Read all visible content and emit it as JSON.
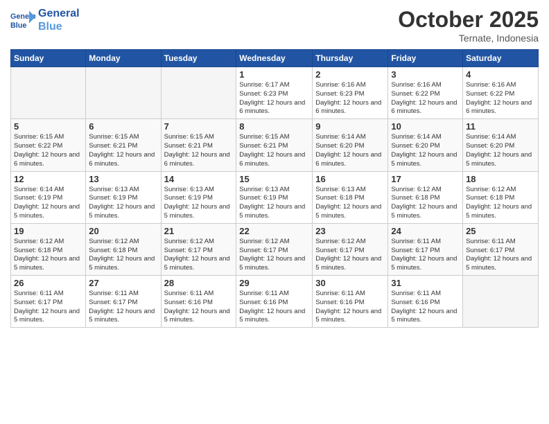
{
  "header": {
    "logo_general": "General",
    "logo_blue": "Blue",
    "month": "October 2025",
    "location": "Ternate, Indonesia"
  },
  "weekdays": [
    "Sunday",
    "Monday",
    "Tuesday",
    "Wednesday",
    "Thursday",
    "Friday",
    "Saturday"
  ],
  "weeks": [
    [
      {
        "day": "",
        "empty": true
      },
      {
        "day": "",
        "empty": true
      },
      {
        "day": "",
        "empty": true
      },
      {
        "day": "1",
        "sunrise": "6:17 AM",
        "sunset": "6:23 PM",
        "daylight": "12 hours and 6 minutes."
      },
      {
        "day": "2",
        "sunrise": "6:16 AM",
        "sunset": "6:23 PM",
        "daylight": "12 hours and 6 minutes."
      },
      {
        "day": "3",
        "sunrise": "6:16 AM",
        "sunset": "6:22 PM",
        "daylight": "12 hours and 6 minutes."
      },
      {
        "day": "4",
        "sunrise": "6:16 AM",
        "sunset": "6:22 PM",
        "daylight": "12 hours and 6 minutes."
      }
    ],
    [
      {
        "day": "5",
        "sunrise": "6:15 AM",
        "sunset": "6:22 PM",
        "daylight": "12 hours and 6 minutes."
      },
      {
        "day": "6",
        "sunrise": "6:15 AM",
        "sunset": "6:21 PM",
        "daylight": "12 hours and 6 minutes."
      },
      {
        "day": "7",
        "sunrise": "6:15 AM",
        "sunset": "6:21 PM",
        "daylight": "12 hours and 6 minutes."
      },
      {
        "day": "8",
        "sunrise": "6:15 AM",
        "sunset": "6:21 PM",
        "daylight": "12 hours and 6 minutes."
      },
      {
        "day": "9",
        "sunrise": "6:14 AM",
        "sunset": "6:20 PM",
        "daylight": "12 hours and 6 minutes."
      },
      {
        "day": "10",
        "sunrise": "6:14 AM",
        "sunset": "6:20 PM",
        "daylight": "12 hours and 5 minutes."
      },
      {
        "day": "11",
        "sunrise": "6:14 AM",
        "sunset": "6:20 PM",
        "daylight": "12 hours and 5 minutes."
      }
    ],
    [
      {
        "day": "12",
        "sunrise": "6:14 AM",
        "sunset": "6:19 PM",
        "daylight": "12 hours and 5 minutes."
      },
      {
        "day": "13",
        "sunrise": "6:13 AM",
        "sunset": "6:19 PM",
        "daylight": "12 hours and 5 minutes."
      },
      {
        "day": "14",
        "sunrise": "6:13 AM",
        "sunset": "6:19 PM",
        "daylight": "12 hours and 5 minutes."
      },
      {
        "day": "15",
        "sunrise": "6:13 AM",
        "sunset": "6:19 PM",
        "daylight": "12 hours and 5 minutes."
      },
      {
        "day": "16",
        "sunrise": "6:13 AM",
        "sunset": "6:18 PM",
        "daylight": "12 hours and 5 minutes."
      },
      {
        "day": "17",
        "sunrise": "6:12 AM",
        "sunset": "6:18 PM",
        "daylight": "12 hours and 5 minutes."
      },
      {
        "day": "18",
        "sunrise": "6:12 AM",
        "sunset": "6:18 PM",
        "daylight": "12 hours and 5 minutes."
      }
    ],
    [
      {
        "day": "19",
        "sunrise": "6:12 AM",
        "sunset": "6:18 PM",
        "daylight": "12 hours and 5 minutes."
      },
      {
        "day": "20",
        "sunrise": "6:12 AM",
        "sunset": "6:18 PM",
        "daylight": "12 hours and 5 minutes."
      },
      {
        "day": "21",
        "sunrise": "6:12 AM",
        "sunset": "6:17 PM",
        "daylight": "12 hours and 5 minutes."
      },
      {
        "day": "22",
        "sunrise": "6:12 AM",
        "sunset": "6:17 PM",
        "daylight": "12 hours and 5 minutes."
      },
      {
        "day": "23",
        "sunrise": "6:12 AM",
        "sunset": "6:17 PM",
        "daylight": "12 hours and 5 minutes."
      },
      {
        "day": "24",
        "sunrise": "6:11 AM",
        "sunset": "6:17 PM",
        "daylight": "12 hours and 5 minutes."
      },
      {
        "day": "25",
        "sunrise": "6:11 AM",
        "sunset": "6:17 PM",
        "daylight": "12 hours and 5 minutes."
      }
    ],
    [
      {
        "day": "26",
        "sunrise": "6:11 AM",
        "sunset": "6:17 PM",
        "daylight": "12 hours and 5 minutes."
      },
      {
        "day": "27",
        "sunrise": "6:11 AM",
        "sunset": "6:17 PM",
        "daylight": "12 hours and 5 minutes."
      },
      {
        "day": "28",
        "sunrise": "6:11 AM",
        "sunset": "6:16 PM",
        "daylight": "12 hours and 5 minutes."
      },
      {
        "day": "29",
        "sunrise": "6:11 AM",
        "sunset": "6:16 PM",
        "daylight": "12 hours and 5 minutes."
      },
      {
        "day": "30",
        "sunrise": "6:11 AM",
        "sunset": "6:16 PM",
        "daylight": "12 hours and 5 minutes."
      },
      {
        "day": "31",
        "sunrise": "6:11 AM",
        "sunset": "6:16 PM",
        "daylight": "12 hours and 5 minutes."
      },
      {
        "day": "",
        "empty": true
      }
    ]
  ]
}
